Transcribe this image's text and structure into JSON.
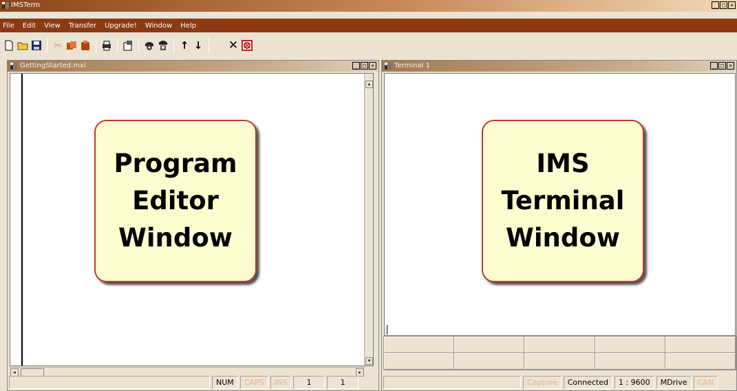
{
  "app": {
    "title": "IMSTerm"
  },
  "menu": [
    "File",
    "Edit",
    "View",
    "Transfer",
    "Upgrade!",
    "Window",
    "Help"
  ],
  "toolbar": {
    "icons": [
      "new-file-icon",
      "open-folder-icon",
      "save-disk-icon",
      "cut-scissors-icon",
      "copy-icon",
      "paste-icon",
      "print-icon",
      "properties-icon",
      "dial-phone-icon",
      "hangup-phone-icon",
      "upload-arrow-icon",
      "download-arrow-icon",
      "close-x-icon",
      "stop-icon"
    ]
  },
  "editor": {
    "title": "GettingStarted.mxi",
    "callout": [
      "Program",
      "Editor",
      "Window"
    ],
    "status": {
      "num": "NUM",
      "caps": "CAPS",
      "ins": "INS",
      "line": "1",
      "col": "1"
    }
  },
  "terminal": {
    "title": "Terminal 1",
    "callout": [
      "IMS",
      "Terminal",
      "Window"
    ],
    "status": {
      "capture": "Capture",
      "connected": "Connected",
      "baud": "1 : 9600",
      "device": "MDrive",
      "can": "CAN"
    }
  }
}
